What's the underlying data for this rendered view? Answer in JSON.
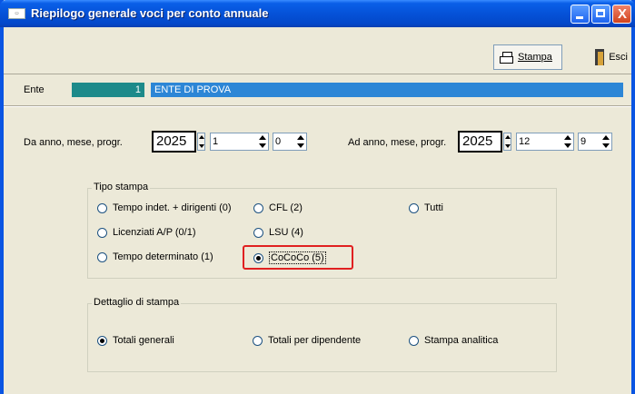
{
  "window": {
    "title": "Riepilogo generale voci per conto annuale",
    "close_glyph": "X"
  },
  "toolbar": {
    "stampa_label": "Stampa",
    "esci_label": "Esci"
  },
  "ente": {
    "label": "Ente",
    "code": "1",
    "name": "ENTE DI PROVA"
  },
  "da": {
    "label": "Da anno, mese, progr.",
    "anno": "2025",
    "mese": "1",
    "progr": "0"
  },
  "ad": {
    "label": "Ad anno, mese, progr.",
    "anno": "2025",
    "mese": "12",
    "progr": "9"
  },
  "tipo_stampa": {
    "title": "Tipo stampa",
    "options": [
      {
        "label": "Tempo indet. + dirigenti (0)",
        "selected": false
      },
      {
        "label": "Licenziati A/P (0/1)",
        "selected": false
      },
      {
        "label": "Tempo determinato (1)",
        "selected": false
      },
      {
        "label": "CFL (2)",
        "selected": false
      },
      {
        "label": "LSU (4)",
        "selected": false
      },
      {
        "label": "CoCoCo (5)",
        "selected": true
      },
      {
        "label": "Tutti",
        "selected": false
      }
    ]
  },
  "dettaglio": {
    "title": "Dettaglio di stampa",
    "options": [
      {
        "label": "Totali generali",
        "selected": true
      },
      {
        "label": "Totali per dipendente",
        "selected": false
      },
      {
        "label": "Stampa analitica",
        "selected": false
      }
    ]
  },
  "colors": {
    "titlebar": "#0552d8",
    "ente_code_bg": "#1d8a8a",
    "ente_name_bg": "#2c86d6",
    "highlight": "#e02020"
  }
}
